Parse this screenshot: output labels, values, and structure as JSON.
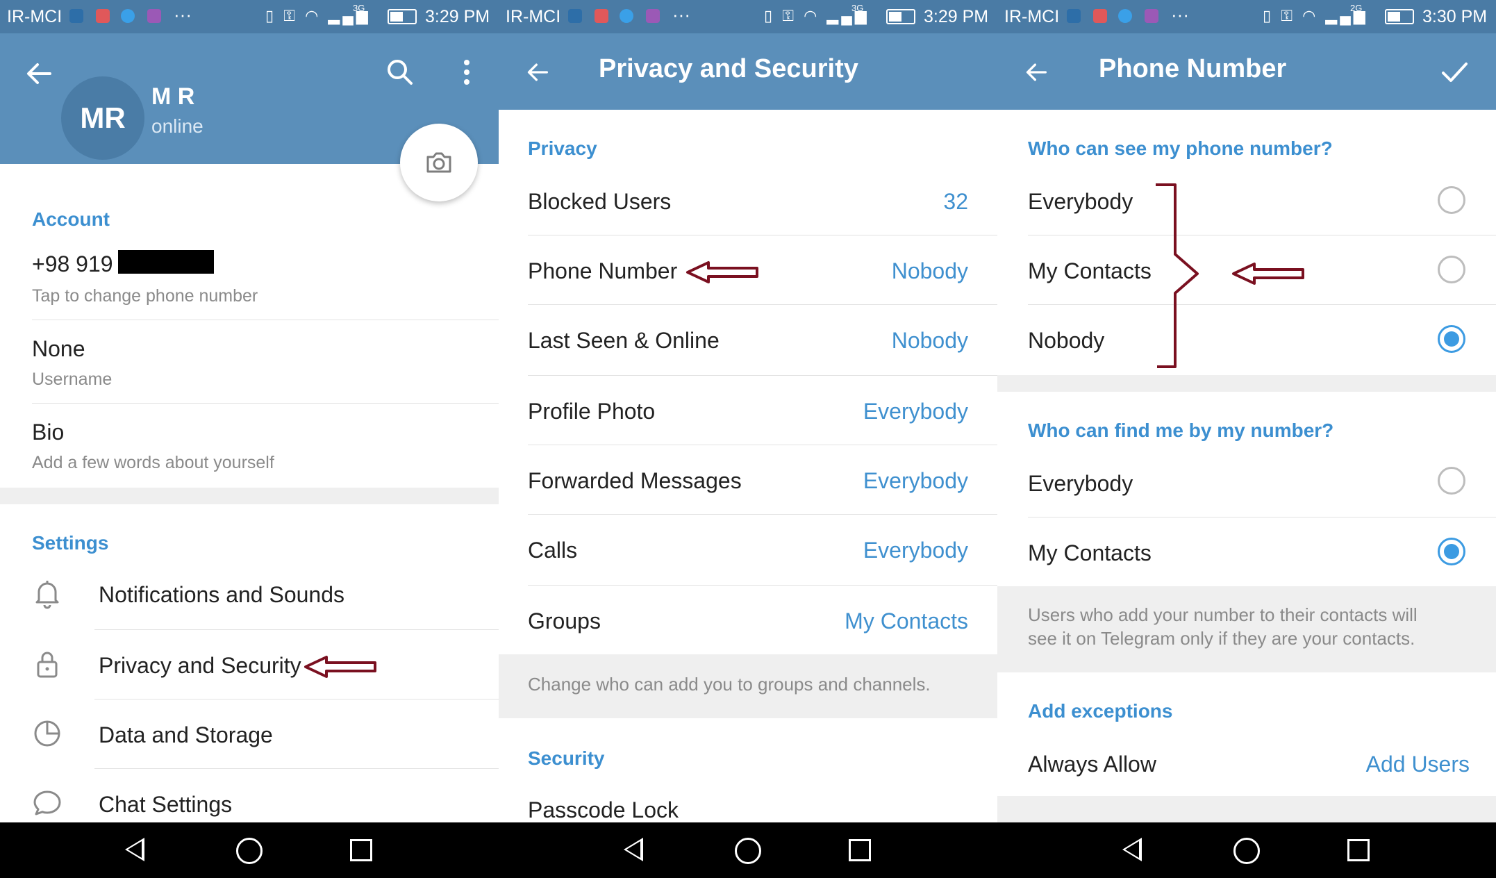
{
  "status": [
    {
      "carrier": "IR-MCI",
      "net": "3G",
      "time": "3:29 PM"
    },
    {
      "carrier": "IR-MCI",
      "net": "3G",
      "time": "3:29 PM"
    },
    {
      "carrier": "IR-MCI",
      "net": "2G",
      "time": "3:30 PM"
    }
  ],
  "profile": {
    "initials": "MR",
    "name": "M R",
    "presence": "online",
    "account_title": "Account",
    "phone": "+98 919",
    "phone_hint": "Tap to change phone number",
    "username_value": "None",
    "username_label": "Username",
    "bio_title": "Bio",
    "bio_hint": "Add a few words about yourself",
    "settings_title": "Settings",
    "menu": [
      {
        "label": "Notifications and Sounds",
        "icon": "bell-icon"
      },
      {
        "label": "Privacy and Security",
        "icon": "lock-icon"
      },
      {
        "label": "Data and Storage",
        "icon": "pie-chart-icon"
      },
      {
        "label": "Chat Settings",
        "icon": "chat-bubble-icon"
      }
    ]
  },
  "privacy": {
    "title": "Privacy and Security",
    "privacy_section": "Privacy",
    "rows": [
      {
        "label": "Blocked Users",
        "value": "32"
      },
      {
        "label": "Phone Number",
        "value": "Nobody"
      },
      {
        "label": "Last Seen & Online",
        "value": "Nobody"
      },
      {
        "label": "Profile Photo",
        "value": "Everybody"
      },
      {
        "label": "Forwarded Messages",
        "value": "Everybody"
      },
      {
        "label": "Calls",
        "value": "Everybody"
      },
      {
        "label": "Groups",
        "value": "My Contacts"
      }
    ],
    "groups_hint": "Change who can add you to groups and channels.",
    "security_section": "Security",
    "passcode": "Passcode Lock"
  },
  "phone_number": {
    "title": "Phone Number",
    "see_title": "Who can see my phone number?",
    "see_options": [
      {
        "label": "Everybody",
        "checked": false
      },
      {
        "label": "My Contacts",
        "checked": false
      },
      {
        "label": "Nobody",
        "checked": true
      }
    ],
    "find_title": "Who can find me by my number?",
    "find_options": [
      {
        "label": "Everybody",
        "checked": false
      },
      {
        "label": "My Contacts",
        "checked": true
      }
    ],
    "find_hint_1": "Users who add your number to their contacts will",
    "find_hint_2": "see it on Telegram only if they are your contacts.",
    "exceptions_title": "Add exceptions",
    "always_allow": "Always Allow",
    "add_users": "Add Users"
  },
  "colors": {
    "header": "#5b8fba",
    "statusbar": "#4a7ba5",
    "accent": "#3c8fd0",
    "annotation": "#7a1020"
  }
}
